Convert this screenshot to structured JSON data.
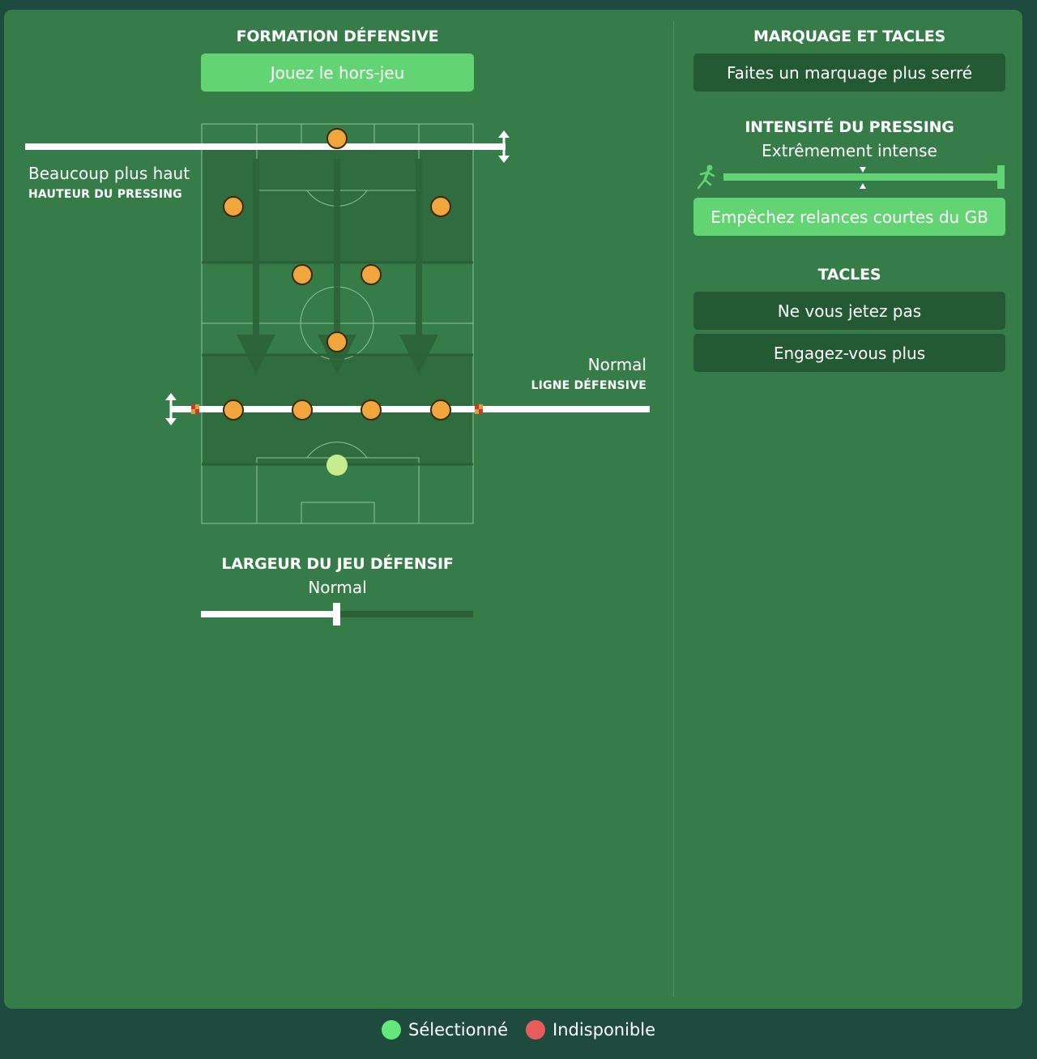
{
  "defensive_formation": {
    "title": "FORMATION DÉFENSIVE",
    "offside_button": "Jouez le hors-jeu"
  },
  "pressing_height": {
    "value": "Beaucoup plus haut",
    "label": "HAUTEUR DU PRESSING"
  },
  "defensive_line": {
    "value": "Normal",
    "label": "LIGNE DÉFENSIVE"
  },
  "defensive_width": {
    "title": "LARGEUR DU JEU DÉFENSIF",
    "value": "Normal",
    "level": 0.5
  },
  "marking": {
    "title": "MARQUAGE ET TACLES",
    "button": "Faites un marquage plus serré"
  },
  "pressing_intensity": {
    "title": "INTENSITÉ DU PRESSING",
    "value": "Extrêmement intense",
    "level": 1.0,
    "gk_button": "Empêchez relances courtes du GB"
  },
  "tackling": {
    "title": "TACLES",
    "options": [
      "Ne vous jetez pas",
      "Engagez-vous plus"
    ]
  },
  "legend": {
    "selected": "Sélectionné",
    "unavailable": "Indisponible"
  },
  "colors": {
    "panel": "#367c48",
    "background": "#1f4a3e",
    "selected": "#63d473",
    "dark_button": "#235a33",
    "player": "#f0a63c",
    "goalkeeper": "#c8ec8c",
    "unavailable": "#e85c5c"
  }
}
